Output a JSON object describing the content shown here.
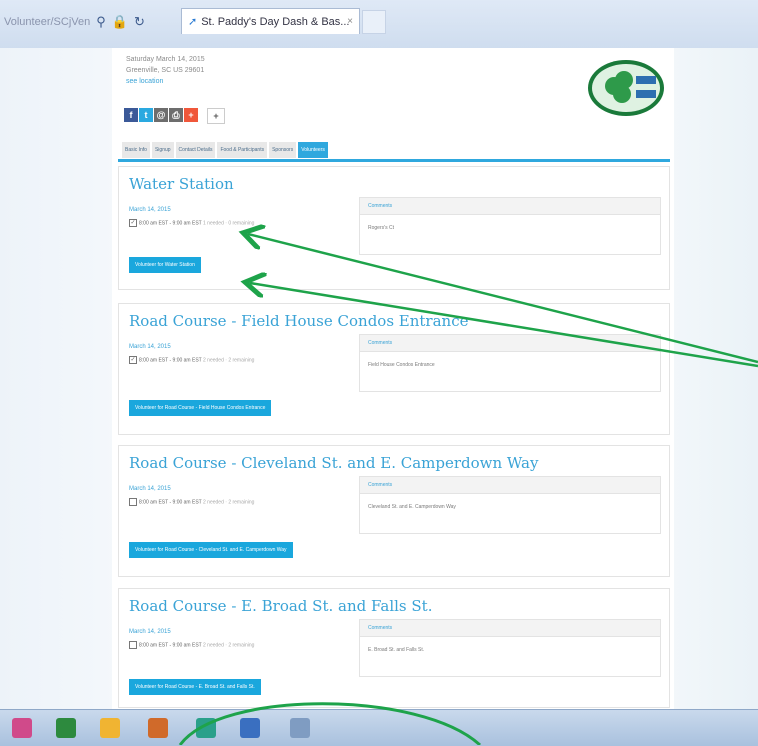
{
  "browser": {
    "address_text": "Volunteer/SCjVen",
    "tab_title": "St. Paddy's Day Dash & Bas...",
    "tab_close": "×",
    "search_icon": "search-icon",
    "lock_icon": "lock-icon",
    "refresh_icon": "refresh-icon"
  },
  "event": {
    "date_line": "Saturday March 14, 2015",
    "location_line": "Greenville, SC US 29601",
    "map_link": "see location"
  },
  "share": {
    "plus_label": "+"
  },
  "tabs": [
    "Basic Info",
    "Signup",
    "Contact Details",
    "Food & Participants",
    "Sponsors",
    "Volunteers"
  ],
  "active_tab_index": 5,
  "colors": {
    "accent": "#2fa8de",
    "button": "#1aa7dd",
    "annotation": "#1ea34a"
  },
  "slots": [
    {
      "title": "Water Station",
      "date": "March 14, 2015",
      "time": "8:00 am EST - 9:00 am EST",
      "needed": "1 needed · 0 remaining",
      "checked": true,
      "button": "Volunteer for Water Station",
      "comments_label": "Comments",
      "comment": "Rogers's Ct"
    },
    {
      "title": "Road Course - Field House Condos Entrance",
      "date": "March 14, 2015",
      "time": "8:00 am EST - 9:00 am EST",
      "needed": "2 needed · 2 remaining",
      "checked": true,
      "button": "Volunteer for Road Course - Field House Condos Entrance",
      "comments_label": "Comments",
      "comment": "Field House Condos Entrance"
    },
    {
      "title": "Road Course - Cleveland St. and E. Camperdown Way",
      "date": "March 14, 2015",
      "time": "8:00 am EST - 9:00 am EST",
      "needed": "2 needed · 2 remaining",
      "checked": false,
      "button": "Volunteer for Road Course - Cleveland St. and E. Camperdown Way",
      "comments_label": "Comments",
      "comment": "Cleveland St. and E. Camperdown Way"
    },
    {
      "title": "Road Course - E. Broad St. and Falls St.",
      "date": "March 14, 2015",
      "time": "8:00 am EST - 9:00 am EST",
      "needed": "2 needed · 2 remaining",
      "checked": false,
      "button": "Volunteer for Road Course - E. Broad St. and Falls St.",
      "comments_label": "Comments",
      "comment": "E. Broad St. and Falls St."
    }
  ]
}
